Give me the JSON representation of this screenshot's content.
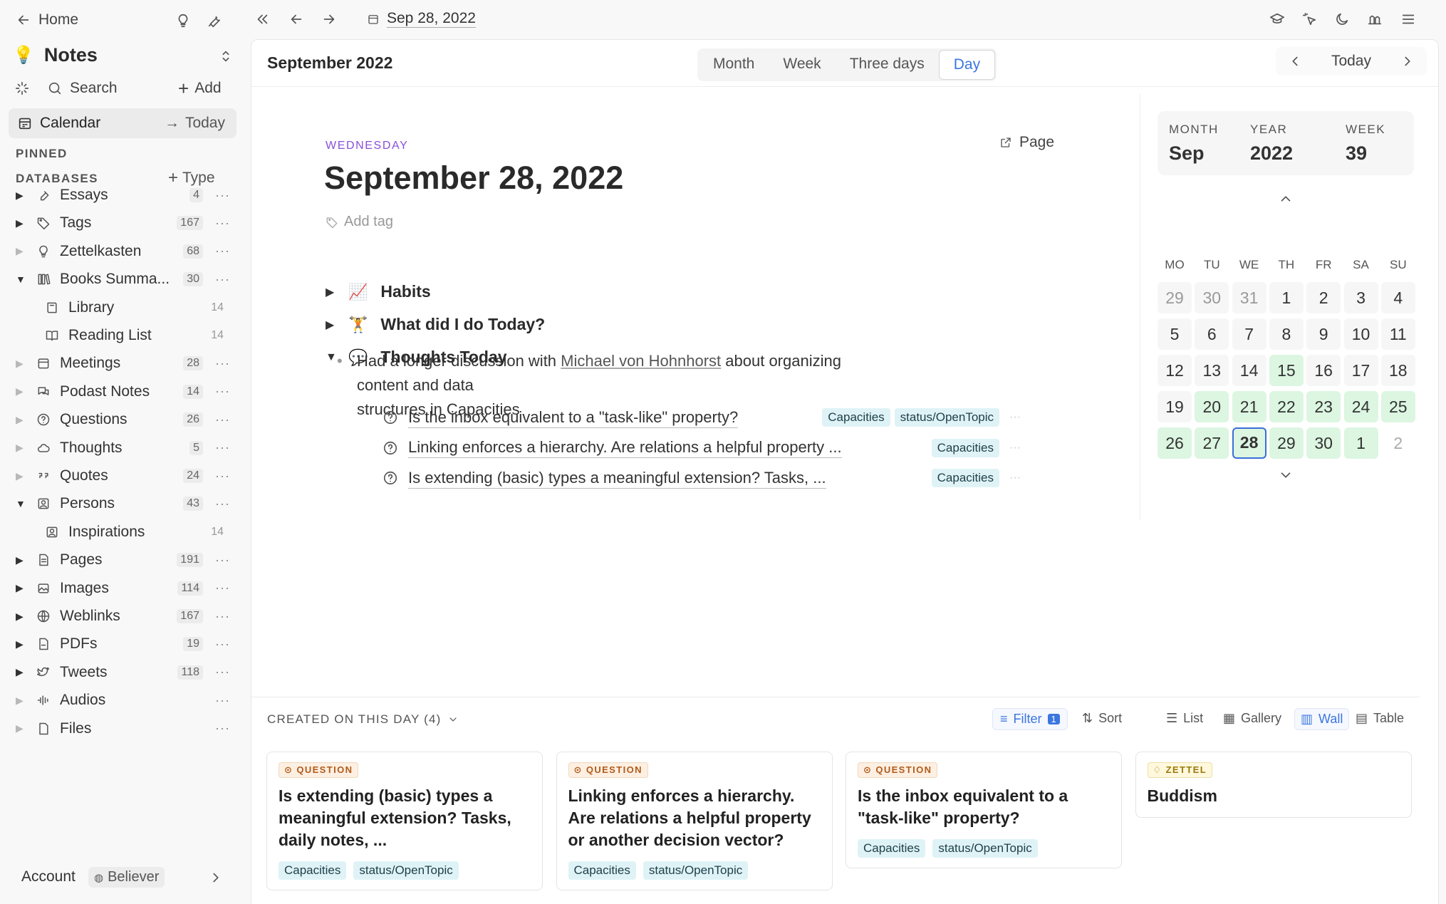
{
  "sidebar": {
    "home": "Home",
    "space": "Notes",
    "search": "Search",
    "add": "Add",
    "calendar": "Calendar",
    "today": "Today",
    "pinned": "PINNED",
    "databases": "DATABASES",
    "type": "Type",
    "items": [
      {
        "label": "Essays",
        "count": "4",
        "icon": "pen-nib-icon",
        "state": "collapsed"
      },
      {
        "label": "Tags",
        "count": "167",
        "icon": "tag-icon",
        "state": "collapsed"
      },
      {
        "label": "Zettelkasten",
        "count": "68",
        "icon": "lightbulb-icon",
        "state": "collapsed-light"
      },
      {
        "label": "Books Summa...",
        "count": "30",
        "icon": "books-icon",
        "state": "expanded"
      },
      {
        "label": "Library",
        "count": "14",
        "icon": "book-icon",
        "state": "sub"
      },
      {
        "label": "Reading List",
        "count": "14",
        "icon": "open-book-icon",
        "state": "sub"
      },
      {
        "label": "Meetings",
        "count": "28",
        "icon": "calendar-icon",
        "state": "collapsed-light"
      },
      {
        "label": "Podast Notes",
        "count": "14",
        "icon": "chat-icon",
        "state": "collapsed-light"
      },
      {
        "label": "Questions",
        "count": "26",
        "icon": "question-icon",
        "state": "collapsed-light"
      },
      {
        "label": "Thoughts",
        "count": "5",
        "icon": "cloud-icon",
        "state": "collapsed-light"
      },
      {
        "label": "Quotes",
        "count": "24",
        "icon": "quote-icon",
        "state": "collapsed-light"
      },
      {
        "label": "Persons",
        "count": "43",
        "icon": "person-icon",
        "state": "expanded"
      },
      {
        "label": "Inspirations",
        "count": "14",
        "icon": "person-icon",
        "state": "sub"
      },
      {
        "label": "Pages",
        "count": "191",
        "icon": "page-icon",
        "state": "collapsed"
      },
      {
        "label": "Images",
        "count": "114",
        "icon": "image-icon",
        "state": "collapsed"
      },
      {
        "label": "Weblinks",
        "count": "167",
        "icon": "globe-icon",
        "state": "collapsed"
      },
      {
        "label": "PDFs",
        "count": "19",
        "icon": "pdf-icon",
        "state": "collapsed"
      },
      {
        "label": "Tweets",
        "count": "118",
        "icon": "twitter-icon",
        "state": "collapsed"
      },
      {
        "label": "Audios",
        "count": "",
        "icon": "audio-icon",
        "state": "collapsed-light"
      },
      {
        "label": "Files",
        "count": "",
        "icon": "file-icon",
        "state": "collapsed-light"
      }
    ],
    "account": "Account",
    "plan": "Believer"
  },
  "topbar": {
    "date": "Sep 28, 2022"
  },
  "calendar_header": {
    "title": "September 2022",
    "views": [
      "Month",
      "Week",
      "Three days",
      "Day"
    ],
    "active_view": "Day",
    "today": "Today"
  },
  "day": {
    "weekday": "WEDNESDAY",
    "title": "September 28, 2022",
    "page_link": "Page",
    "add_tag": "Add tag",
    "sections": [
      {
        "emoji": "📈",
        "title": "Habits",
        "expanded": false
      },
      {
        "emoji": "🏋",
        "title": "What did I do Today?",
        "expanded": false
      },
      {
        "emoji": "💬",
        "title": "Thoughts Today",
        "expanded": true
      }
    ],
    "bullet_pre": "Had a longer discussion with ",
    "bullet_link": "Michael von Hohnhorst",
    "bullet_post": " about organizing content and data",
    "bullet_line2": "structures in Capacities",
    "questions": [
      {
        "text": "Is the inbox equivalent to a \"task-like\" property?",
        "tags": [
          "Capacities",
          "status/OpenTopic"
        ]
      },
      {
        "text": "Linking enforces a hierarchy. Are relations a helpful property ...",
        "tags": [
          "Capacities"
        ]
      },
      {
        "text": "Is extending (basic) types a meaningful extension? Tasks, ...",
        "tags": [
          "Capacities"
        ]
      }
    ]
  },
  "mini_calendar": {
    "month_label": "MONTH",
    "month": "Sep",
    "year_label": "YEAR",
    "year": "2022",
    "week_label": "WEEK",
    "week": "39",
    "dow": [
      "MO",
      "TU",
      "WE",
      "TH",
      "FR",
      "SA",
      "SU"
    ],
    "weeks": [
      [
        {
          "d": "29",
          "s": "other"
        },
        {
          "d": "30",
          "s": "other"
        },
        {
          "d": "31",
          "s": "other"
        },
        {
          "d": "1",
          "s": ""
        },
        {
          "d": "2",
          "s": ""
        },
        {
          "d": "3",
          "s": ""
        },
        {
          "d": "4",
          "s": ""
        }
      ],
      [
        {
          "d": "5",
          "s": ""
        },
        {
          "d": "6",
          "s": ""
        },
        {
          "d": "7",
          "s": ""
        },
        {
          "d": "8",
          "s": ""
        },
        {
          "d": "9",
          "s": ""
        },
        {
          "d": "10",
          "s": ""
        },
        {
          "d": "11",
          "s": ""
        }
      ],
      [
        {
          "d": "12",
          "s": ""
        },
        {
          "d": "13",
          "s": ""
        },
        {
          "d": "14",
          "s": ""
        },
        {
          "d": "15",
          "s": "green"
        },
        {
          "d": "16",
          "s": ""
        },
        {
          "d": "17",
          "s": ""
        },
        {
          "d": "18",
          "s": ""
        }
      ],
      [
        {
          "d": "19",
          "s": ""
        },
        {
          "d": "20",
          "s": "green"
        },
        {
          "d": "21",
          "s": "green"
        },
        {
          "d": "22",
          "s": "green"
        },
        {
          "d": "23",
          "s": "green"
        },
        {
          "d": "24",
          "s": "green"
        },
        {
          "d": "25",
          "s": "green"
        }
      ],
      [
        {
          "d": "26",
          "s": "green"
        },
        {
          "d": "27",
          "s": "green"
        },
        {
          "d": "28",
          "s": "sel"
        },
        {
          "d": "29",
          "s": "green"
        },
        {
          "d": "30",
          "s": "green"
        },
        {
          "d": "1",
          "s": "green"
        },
        {
          "d": "2",
          "s": "faint"
        }
      ]
    ]
  },
  "created": {
    "title": "CREATED ON THIS DAY (4)",
    "filter": "Filter",
    "filter_count": "1",
    "sort": "Sort",
    "views": [
      "List",
      "Gallery",
      "Wall",
      "Table"
    ],
    "active_view": "Wall",
    "cards": [
      {
        "type": "QUESTION",
        "title": "Is extending (basic) types a meaningful extension? Tasks, daily notes, ...",
        "tags": [
          "Capacities",
          "status/OpenTopic"
        ]
      },
      {
        "type": "QUESTION",
        "title": "Linking enforces a hierarchy. Are relations a helpful property or another decision vector?",
        "tags": [
          "Capacities",
          "status/OpenTopic"
        ]
      },
      {
        "type": "QUESTION",
        "title": "Is the inbox equivalent to a \"task-like\" property?",
        "tags": [
          "Capacities",
          "status/OpenTopic"
        ]
      },
      {
        "type": "ZETTEL",
        "title": "Buddism",
        "tags": []
      }
    ]
  }
}
